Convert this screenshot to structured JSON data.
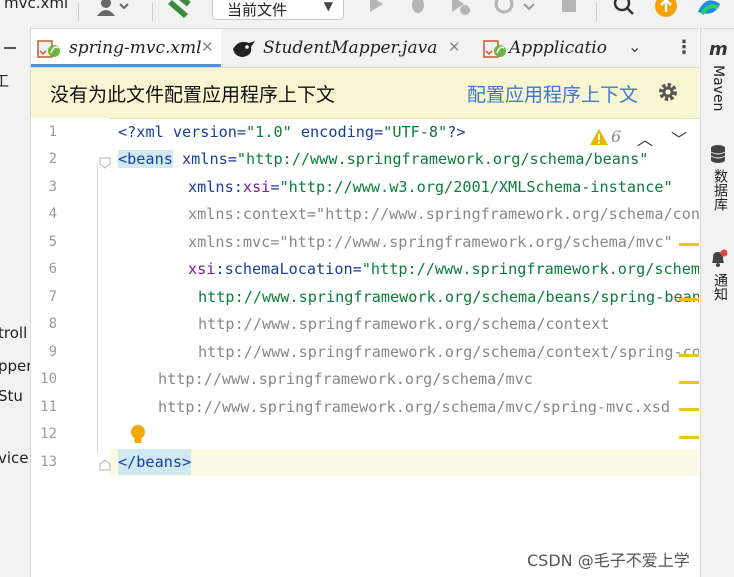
{
  "toolbar": {
    "file_fragment": "mvc.xml",
    "run_config": "当前文件"
  },
  "left_panel_fragments": [
    "工",
    "troll",
    "pper",
    "Stu",
    "vice"
  ],
  "tabs": [
    {
      "label": "spring-mvc.xml",
      "active": true,
      "closable": true
    },
    {
      "label": "StudentMapper.java",
      "active": false,
      "closable": true
    },
    {
      "label": "Appplicatio",
      "active": false,
      "closable": false
    }
  ],
  "banner": {
    "message": "没有为此文件配置应用程序上下文",
    "link": "配置应用程序上下文"
  },
  "inspections": {
    "warning_count": "6"
  },
  "editor": {
    "line_numbers": [
      "1",
      "2",
      "3",
      "4",
      "5",
      "6",
      "7",
      "8",
      "9",
      "10",
      "11",
      "12",
      "13"
    ],
    "lines": {
      "l1": {
        "open": "<?",
        "tag": "xml",
        "a1": " version=",
        "v1": "\"1.0\"",
        "a2": " encoding=",
        "v2": "\"UTF-8\"",
        "close": "?>"
      },
      "l2": {
        "tag": "<beans",
        "attr": " xmlns=",
        "val": "\"http://www.springframework.org/schema/beans\""
      },
      "l3": {
        "ns": "xmlns",
        "colon": ":",
        "attr": "xsi",
        "eq": "=",
        "val": "\"http://www.w3.org/2001/XMLSchema-instance\""
      },
      "l4": "xmlns:context=\"http://www.springframework.org/schema/context\"",
      "l5": "xmlns:mvc=\"http://www.springframework.org/schema/mvc\"",
      "l6": {
        "ns": "xsi",
        "colon": ":",
        "attr": "schemaLocation",
        "eq": "=",
        "val": "\"http://www.springframework.org/schema/beans"
      },
      "l7": "http://www.springframework.org/schema/beans/spring-beans.xsd",
      "l8": "http://www.springframework.org/schema/context",
      "l9": "http://www.springframework.org/schema/context/spring-context.xsd",
      "l10": "http://www.springframework.org/schema/mvc",
      "l11": "http://www.springframework.org/schema/mvc/spring-mvc.xsd",
      "l13": "</beans>"
    }
  },
  "right_panel": {
    "maven": "Maven",
    "database": "数据库",
    "notifications": "通知"
  },
  "watermark": "CSDN @毛子不爱上学",
  "colors": {
    "banner_bg": "#f8f6d2",
    "link": "#3d79c9",
    "tag": "#1a3d9b",
    "string": "#0b7d3c",
    "namespace": "#7a1aa8",
    "warning": "#e8c619"
  }
}
